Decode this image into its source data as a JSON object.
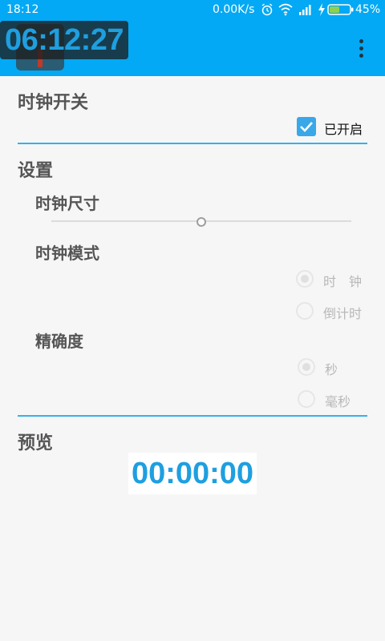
{
  "status_bar": {
    "time": "18:12",
    "network_speed": "0.00K/s",
    "battery_percent": "45%",
    "icons": [
      "alarm-icon",
      "wifi-icon",
      "signal-icon",
      "charging-icon",
      "battery-icon"
    ]
  },
  "app_bar": {
    "background_color": "#03a9f4",
    "floating_clock_time": "06:12:27",
    "menu_icon": "overflow-menu-icon"
  },
  "clock_switch": {
    "title": "时钟开关",
    "checkbox_label": "已开启",
    "checked": true
  },
  "settings": {
    "title": "设置",
    "clock_size": {
      "title": "时钟尺寸",
      "level": 0.5
    },
    "clock_mode": {
      "title": "时钟模式",
      "options": [
        "时　钟",
        "倒计时"
      ],
      "selected": "时　钟"
    },
    "precision": {
      "title": "精确度",
      "options": [
        "秒",
        "毫秒"
      ],
      "selected": "秒"
    }
  },
  "preview": {
    "title": "预览",
    "display_time": "00:00:00"
  },
  "accent_color": "#35b2e8"
}
